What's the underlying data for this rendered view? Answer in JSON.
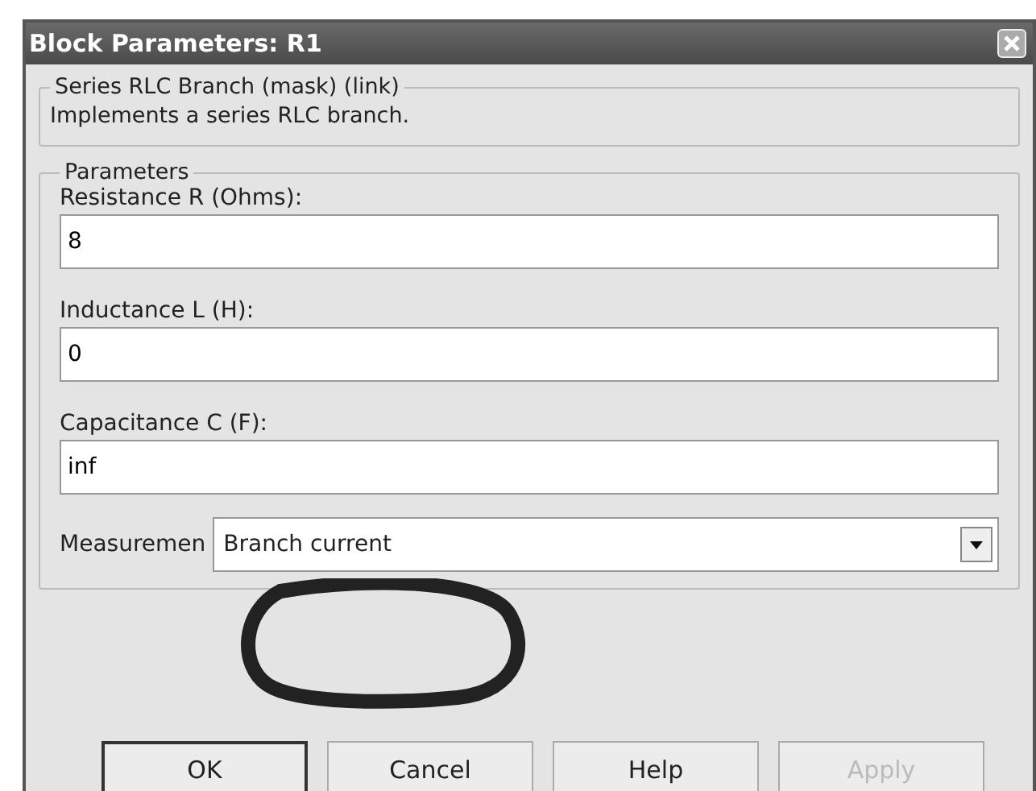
{
  "window": {
    "title": "Block Parameters: R1"
  },
  "description_group": {
    "title": "Series RLC Branch (mask) (link)",
    "text": "Implements a series RLC branch."
  },
  "parameters_group": {
    "title": "Parameters",
    "fields": [
      {
        "label": "Resistance R (Ohms):",
        "value": "8"
      },
      {
        "label": "Inductance L (H):",
        "value": "0"
      },
      {
        "label": "Capacitance C (F):",
        "value": "inf"
      }
    ],
    "measurement": {
      "label": "Measuremen",
      "value": "Branch current"
    }
  },
  "buttons": [
    {
      "label": "OK",
      "disabled": false,
      "default": true
    },
    {
      "label": "Cancel",
      "disabled": false,
      "default": false
    },
    {
      "label": "Help",
      "disabled": false,
      "default": false
    },
    {
      "label": "Apply",
      "disabled": true,
      "default": false
    }
  ]
}
